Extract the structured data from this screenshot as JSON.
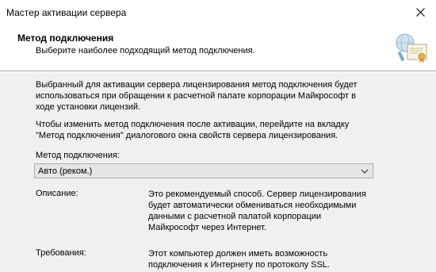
{
  "window": {
    "title": "Мастер активации сервера"
  },
  "header": {
    "title": "Метод подключения",
    "subtitle": "Выберите наиболее подходящий метод подключения."
  },
  "body": {
    "paragraph1": "Выбранный для активации сервера лицензирования метод подключения будет использоваться при обращении к расчетной палате корпорации Майкрософт в ходе установки лицензий.",
    "paragraph2": "Чтобы изменить метод подключения после активации, перейдите на вкладку \"Метод подключения\" диалогового окна свойств сервера лицензирования.",
    "method_label": "Метод подключения:",
    "method_value": "Авто (реком.)",
    "description_label": "Описание:",
    "description_text": "Это рекомендуемый способ. Сервер лицензирования будет автоматически обмениваться необходимыми данными с расчетной палатой корпорации Майкрософт через Интернет.",
    "requirements_label": "Требования:",
    "requirements_text": "Этот компьютер должен иметь возможность подключения к Интернету по протоколу SSL."
  },
  "icons": {
    "close": "close-icon",
    "header_image": "certificate-icon",
    "dropdown": "chevron-down-icon"
  }
}
